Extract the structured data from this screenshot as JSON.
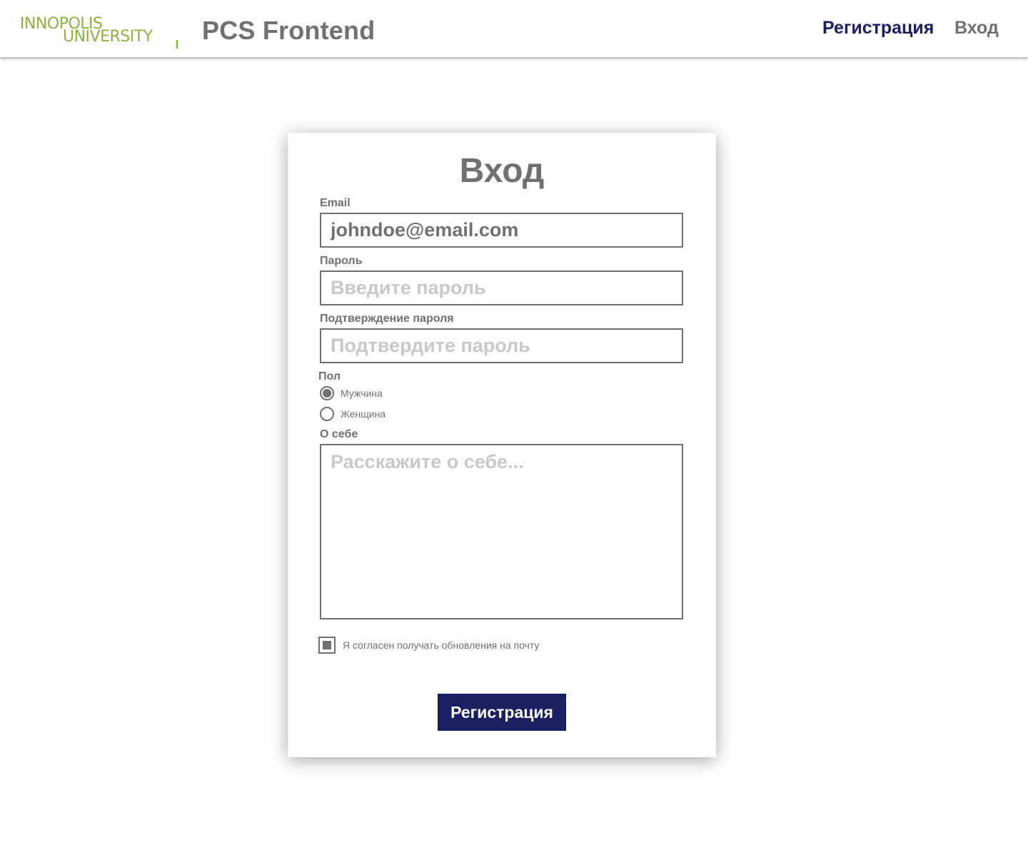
{
  "header": {
    "logo_text_line1": "INNOPOLIS",
    "logo_text_line2": "UNIVERSITY",
    "app_title": "PCS Frontend",
    "nav": {
      "register": "Регистрация",
      "login": "Вход"
    }
  },
  "form": {
    "title": "Вход",
    "email": {
      "label": "Email",
      "value": "johndoe@email.com"
    },
    "password": {
      "label": "Пароль",
      "placeholder": "Введите пароль"
    },
    "password_confirm": {
      "label": "Подтверждение пароля",
      "placeholder": "Подтвердите пароль"
    },
    "gender": {
      "label": "Пол",
      "options": [
        {
          "label": "Мужчина",
          "selected": true
        },
        {
          "label": "Женщина",
          "selected": false
        }
      ]
    },
    "about": {
      "label": "О себе",
      "placeholder": "Расскажите о себе..."
    },
    "subscribe": {
      "label": "Я согласен получать обновления на почту",
      "checked": true
    },
    "submit_label": "Регистрация"
  },
  "colors": {
    "accent": "#1a1f63",
    "text": "#707070",
    "placeholder": "#c8c8c8",
    "logo_green": "#8ab43c"
  }
}
